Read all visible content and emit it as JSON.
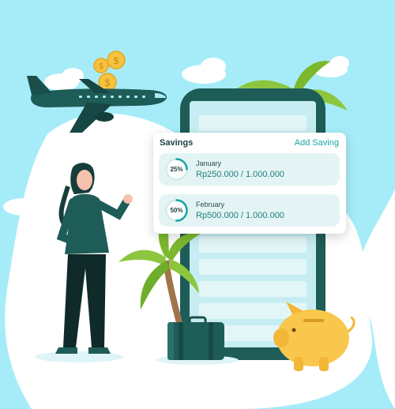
{
  "colors": {
    "sky": "#9fe6f6",
    "phone_dark": "#1e5c58",
    "accent_teal": "#1aa6a3",
    "coin_gold": "#f6c340",
    "palm_green": "#8cc63f",
    "piggy_yellow": "#f8c74c"
  },
  "savings_card": {
    "title": "Savings",
    "add_label": "Add Saving",
    "items": [
      {
        "percent_label": "25%",
        "progress": 0.25,
        "month": "January",
        "amount": "Rp250.000 / 1.000.000"
      },
      {
        "percent_label": "50%",
        "progress": 0.5,
        "month": "February",
        "amount": "Rp500.000 / 1.000.000"
      }
    ]
  },
  "illustration": {
    "elements": [
      "airplane",
      "coins",
      "woman",
      "smartphone",
      "palm-trees",
      "suitcase",
      "piggy-bank",
      "clouds"
    ]
  }
}
